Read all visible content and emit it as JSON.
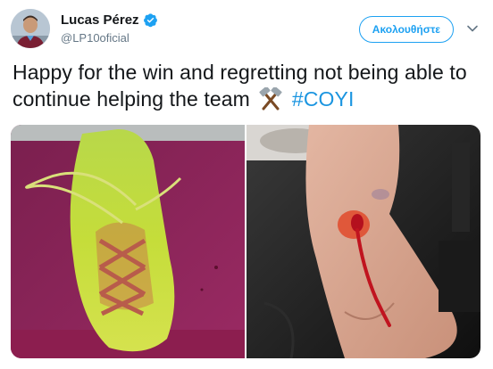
{
  "tweet": {
    "author": {
      "display_name": "Lucas Pérez",
      "handle": "@LP10oficial",
      "avatar_icon": "avatar-photo",
      "verified_icon": "verified-badge-icon"
    },
    "follow_label": "Ακολουθήστε",
    "menu_icon": "chevron-down-icon",
    "text_main": "Happy for the win and regretting not being able to continue helping the team",
    "emoji_icon": "hammers-emoji-icon",
    "hashtag": "#COYI",
    "media": [
      {
        "name": "photo-football-boot",
        "icon": "boot-photo"
      },
      {
        "name": "photo-injured-foot",
        "icon": "foot-photo"
      }
    ],
    "colors": {
      "accent": "#1da1f2",
      "hashtag": "#1b95e0",
      "text": "#14171a",
      "muted": "#657786"
    }
  }
}
